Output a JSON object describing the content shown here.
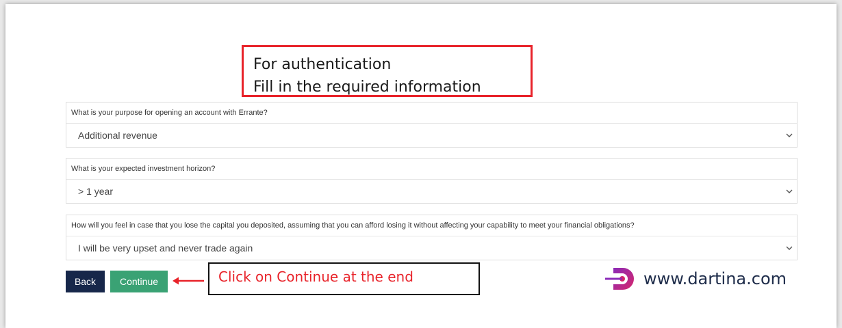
{
  "annotation_top": {
    "line1": "For authentication",
    "line2": "Fill in the required information"
  },
  "questions": [
    {
      "label": "What is your purpose for opening an account with Errante?",
      "selected": "Additional revenue"
    },
    {
      "label": "What is your expected investment horizon?",
      "selected": "> 1 year"
    },
    {
      "label": "How will you feel in case that you lose the capital you deposited, assuming that you can afford losing it without affecting your capability to meet your financial obligations?",
      "selected": "I will be very upset and never trade again"
    }
  ],
  "buttons": {
    "back": "Back",
    "continue": "Continue"
  },
  "annotation_bottom": "Click on Continue at the end",
  "watermark": {
    "text": "www.dartina.com",
    "icon": "dartina-logo-icon"
  },
  "colors": {
    "annotation_red": "#e8232a",
    "back_button": "#17274a",
    "continue_button": "#3aa274",
    "brand_purple": "#8b2ab8",
    "brand_pink": "#d6266b"
  }
}
